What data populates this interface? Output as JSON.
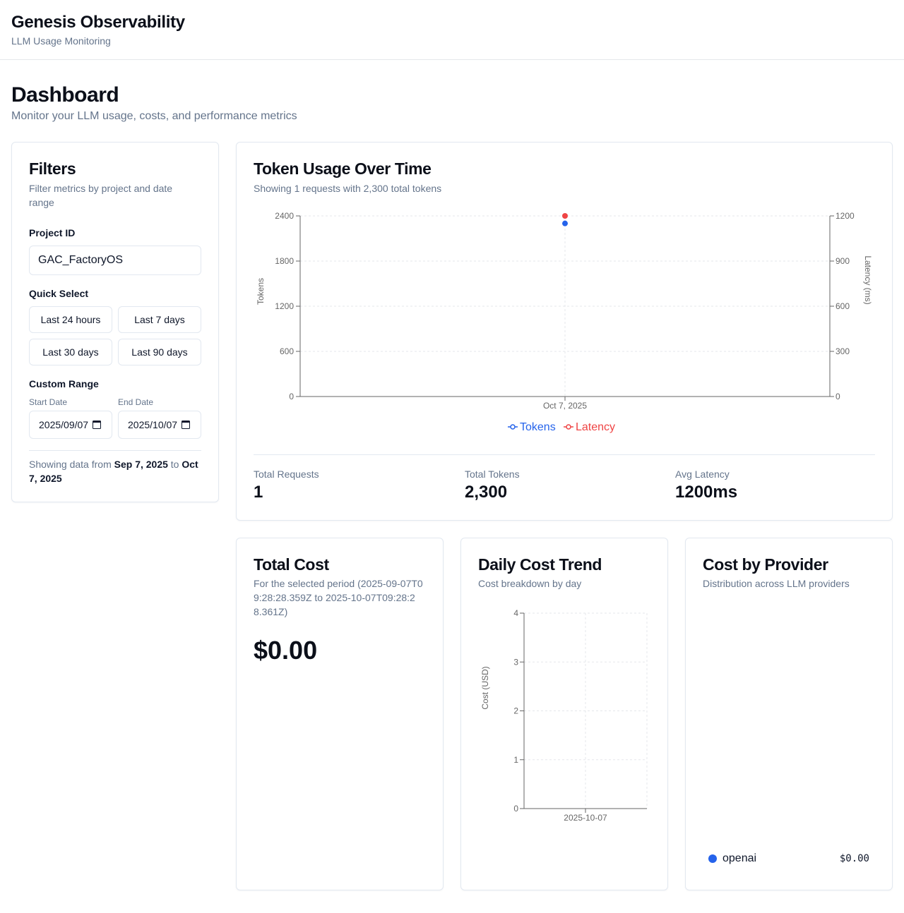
{
  "header": {
    "title": "Genesis Observability",
    "subtitle": "LLM Usage Monitoring"
  },
  "page": {
    "title": "Dashboard",
    "subtitle": "Monitor your LLM usage, costs, and performance metrics"
  },
  "filters": {
    "title": "Filters",
    "description": "Filter metrics by project and date range",
    "project_label": "Project ID",
    "project_value": "GAC_FactoryOS",
    "quick_select_label": "Quick Select",
    "quick": [
      "Last 24 hours",
      "Last 7 days",
      "Last 30 days",
      "Last 90 days"
    ],
    "custom_range_label": "Custom Range",
    "start_label": "Start Date",
    "start_value": "2025/09/07",
    "end_label": "End Date",
    "end_value": "2025/10/07",
    "range_prefix": "Showing data from",
    "range_start": "Sep 7, 2025",
    "range_mid": "to",
    "range_end": "Oct 7, 2025"
  },
  "token_usage": {
    "title": "Token Usage Over Time",
    "description": "Showing 1 requests with 2,300 total tokens",
    "stats": {
      "requests_label": "Total Requests",
      "requests_value": "1",
      "tokens_label": "Total Tokens",
      "tokens_value": "2,300",
      "latency_label": "Avg Latency",
      "latency_value": "1200ms"
    }
  },
  "total_cost": {
    "title": "Total Cost",
    "description": "For the selected period (2025-09-07T09:28:28.359Z to 2025-10-07T09:28:28.361Z)",
    "value": "$0.00"
  },
  "daily_cost": {
    "title": "Daily Cost Trend",
    "description": "Cost breakdown by day"
  },
  "provider": {
    "title": "Cost by Provider",
    "description": "Distribution across LLM providers",
    "items": [
      {
        "name": "openai",
        "value": "$0.00",
        "color": "#2563eb"
      }
    ]
  },
  "colors": {
    "tokens": "#2563eb",
    "latency": "#ef4444",
    "axis": "#666666",
    "grid": "#e5e7eb"
  },
  "chart_data": [
    {
      "type": "line",
      "x": [
        "Oct 7, 2025"
      ],
      "series": [
        {
          "name": "Tokens",
          "axis": "left",
          "values": [
            2300
          ]
        },
        {
          "name": "Latency",
          "axis": "right",
          "values": [
            1200
          ]
        }
      ],
      "ylabel": "Tokens",
      "y2label": "Latency (ms)",
      "ylim": [
        0,
        2400
      ],
      "y2lim": [
        0,
        1200
      ],
      "yticks": [
        "0",
        "600",
        "1200",
        "1800",
        "2400"
      ],
      "y2ticks": [
        "0",
        "300",
        "600",
        "900",
        "1200"
      ],
      "legend": "bottom",
      "grid": true
    },
    {
      "type": "bar",
      "categories": [
        "2025-10-07"
      ],
      "values": [
        0
      ],
      "ylabel": "Cost (USD)",
      "ylim": [
        0,
        4
      ],
      "yticks": [
        "0",
        "1",
        "2",
        "3",
        "4"
      ],
      "grid": true
    }
  ]
}
